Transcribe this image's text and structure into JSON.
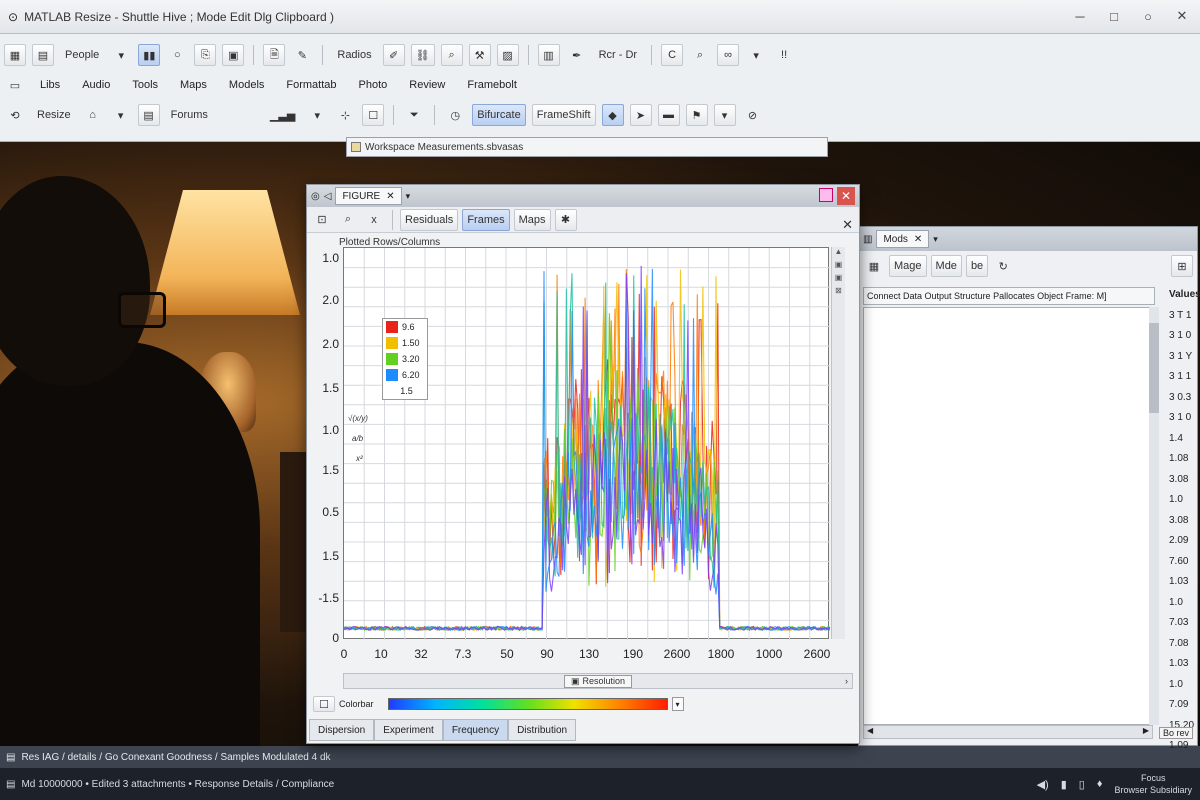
{
  "window": {
    "title": "MATLAB  Resize - Shuttle Hive ; Mode Edit Dlg Clipboard )",
    "controls": [
      "─",
      "□",
      "○",
      "✕"
    ]
  },
  "toolbar1": {
    "people_label": "People",
    "radios_label": "Radios",
    "range_label": "Rcr - Dr",
    "c_label": "C",
    "pin_label": "!!"
  },
  "menu": {
    "items": [
      "Libs",
      "Audio",
      "Tools",
      "Maps",
      "Models",
      "Formattab",
      "Photo",
      "Review",
      "Framebolt"
    ]
  },
  "toolbar3": {
    "left_label": "Resize",
    "forums_label": "Forums",
    "bifurcate_label": "Bifurcate",
    "frameshift_label": "FrameShift"
  },
  "address": {
    "text": "Workspace  Measurements.sbvasas"
  },
  "figure": {
    "tab_label": "FIGURE",
    "tools": [
      "Residuals",
      "Frames",
      "Maps"
    ],
    "plot_title": "Plotted Rows/Columns",
    "hscroll_label": "Resolution",
    "colormap_label": "Colorbar",
    "bottom_tabs": [
      "Dispersion",
      "Experiment",
      "Frequency",
      "Distribution"
    ],
    "legend": [
      {
        "label": "9.6",
        "color": "#e8231c"
      },
      {
        "label": "1.50",
        "color": "#f0c000"
      },
      {
        "label": "3.20",
        "color": "#63d021"
      },
      {
        "label": "6.20",
        "color": "#1e8cff"
      }
    ],
    "legend_extra": "1.5",
    "yticks": [
      "1.0",
      "2.0",
      "2.0",
      "1.5",
      "1.0",
      "1.5",
      "0.5",
      "1.5",
      "-1.5",
      "0"
    ],
    "xticks": [
      "0",
      "10",
      "32",
      "7.3",
      "50",
      "90",
      "130",
      "190",
      "2600",
      "1800",
      "1000",
      "2600"
    ],
    "ylabel_frags": [
      "√(x/y)",
      "a/b",
      "x²"
    ]
  },
  "chart_data": {
    "type": "line",
    "title": "Plotted Rows/Columns",
    "xlabel": "",
    "ylabel": "",
    "x_tick_labels": [
      "0",
      "10",
      "32",
      "7.3",
      "50",
      "90",
      "130",
      "190",
      "2600",
      "1800",
      "1000",
      "2600"
    ],
    "y_tick_labels": [
      "1.0",
      "2.0",
      "2.0",
      "1.5",
      "1.0",
      "1.5",
      "0.5",
      "1.5",
      "-1.5",
      "0"
    ],
    "active_range": [
      0.41,
      0.77
    ],
    "peak_level": 0.98,
    "series": [
      {
        "name": "9.6",
        "color": "#e8231c"
      },
      {
        "name": "1.50",
        "color": "#f0c000"
      },
      {
        "name": "3.20",
        "color": "#63d021"
      },
      {
        "name": "6.20",
        "color": "#1e8cff"
      }
    ]
  },
  "rightpanel": {
    "tab_label": "Mods",
    "toolbar": [
      "Mage",
      "Mde",
      "be"
    ],
    "path_text": "Connect Data Output Structure Pallocates Object Frame: M]",
    "header": "Values",
    "values": [
      "3 T 1",
      "3 1 0",
      "3 1 Y",
      "3 1 1",
      "3 0.3",
      "3 1 0",
      "1.4",
      "1.08",
      "3.08",
      "1.0",
      "3.08",
      "2.09",
      "7.60",
      "1.03",
      "1.0",
      "7.03",
      "7.08",
      "1.03",
      "1.0",
      "7.09",
      "15.20",
      "1.09"
    ],
    "bottom_btn": "Bo rev"
  },
  "status1": {
    "text": "Res  IAG / details  /  Go Conexant   Goodness  /  Samples  Modulated  4 dk"
  },
  "status2": {
    "text": "Md  10000000  •  Edited  3 attachments  •  Response Details  /  Compliance",
    "time": "Focus",
    "date": "Browser  Subsidiary"
  }
}
